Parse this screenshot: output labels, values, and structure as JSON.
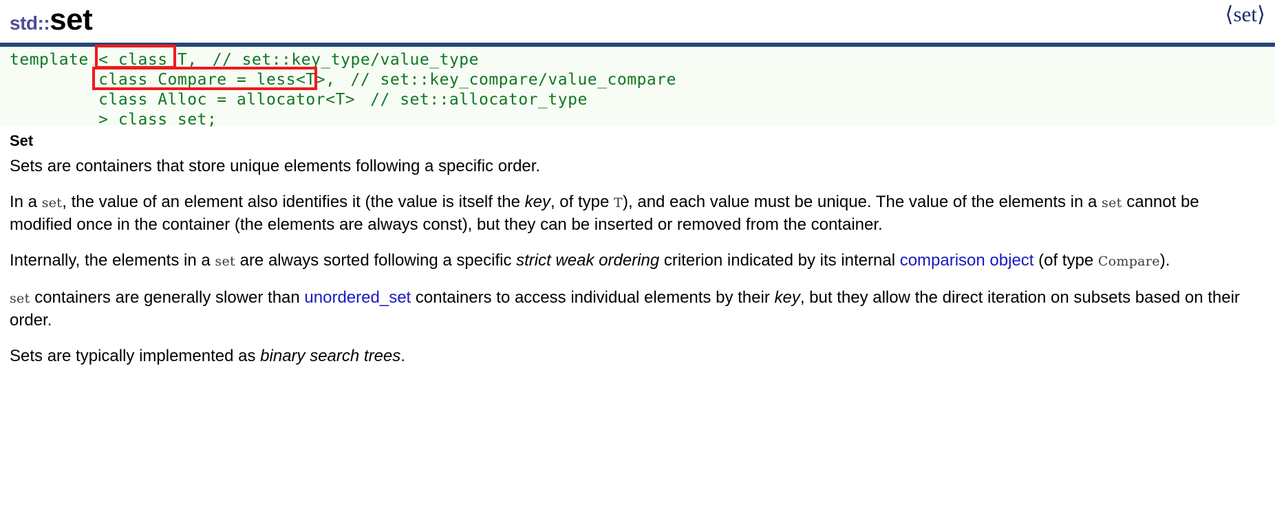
{
  "header": {
    "namespace": "std::",
    "name": "set",
    "include": "⟨set⟩"
  },
  "code": {
    "lines": [
      {
        "code": "template < class T,",
        "comment": "// set::key_type/value_type"
      },
      {
        "code": "         class Compare = less<T>,",
        "comment": "// set::key_compare/value_compare"
      },
      {
        "code": "         class Alloc = allocator<T>",
        "comment": "// set::allocator_type"
      },
      {
        "code": "         > class set;",
        "comment": ""
      }
    ],
    "highlight_color": "#ef1a1a",
    "text_color": "#117722",
    "background": "#f7fcf5",
    "top_border_color": "#26457e",
    "highlights": [
      "class T,",
      "class Compare = less<T>,"
    ]
  },
  "content": {
    "section_title": "Set",
    "paragraphs": [
      {
        "id": "p1",
        "parts": [
          {
            "type": "text",
            "value": "Sets are containers that store unique elements following a specific order."
          }
        ]
      },
      {
        "id": "p2",
        "parts": [
          {
            "type": "text",
            "value": "In a "
          },
          {
            "type": "code",
            "value": "set"
          },
          {
            "type": "text",
            "value": ", the value of an element also identifies it (the value is itself the "
          },
          {
            "type": "em",
            "value": "key"
          },
          {
            "type": "text",
            "value": ", of type "
          },
          {
            "type": "code",
            "value": "T"
          },
          {
            "type": "text",
            "value": "), and each value must be unique. The value of the elements in a "
          },
          {
            "type": "code",
            "value": "set"
          },
          {
            "type": "text",
            "value": " cannot be modified once in the container (the elements are always const), but they can be inserted or removed from the container."
          }
        ]
      },
      {
        "id": "p3",
        "parts": [
          {
            "type": "text",
            "value": "Internally, the elements in a "
          },
          {
            "type": "code",
            "value": "set"
          },
          {
            "type": "text",
            "value": " are always sorted following a specific "
          },
          {
            "type": "em",
            "value": "strict weak ordering"
          },
          {
            "type": "text",
            "value": " criterion indicated by its internal "
          },
          {
            "type": "link",
            "value": "comparison object"
          },
          {
            "type": "text",
            "value": " (of type "
          },
          {
            "type": "code",
            "value": "Compare"
          },
          {
            "type": "text",
            "value": ")."
          }
        ]
      },
      {
        "id": "p4",
        "parts": [
          {
            "type": "code",
            "value": "set"
          },
          {
            "type": "text",
            "value": " containers are generally slower than "
          },
          {
            "type": "link",
            "value": "unordered_set"
          },
          {
            "type": "text",
            "value": " containers to access individual elements by their "
          },
          {
            "type": "em",
            "value": "key"
          },
          {
            "type": "text",
            "value": ", but they allow the direct iteration on subsets based on their order."
          }
        ]
      },
      {
        "id": "p5",
        "parts": [
          {
            "type": "text",
            "value": "Sets are typically implemented as "
          },
          {
            "type": "em",
            "value": "binary search trees"
          },
          {
            "type": "text",
            "value": "."
          }
        ]
      }
    ]
  },
  "colors": {
    "link": "#1919c4",
    "namespace": "#4c4f93",
    "include": "#1f2d6e",
    "inline_code": "#3b3b3b"
  }
}
